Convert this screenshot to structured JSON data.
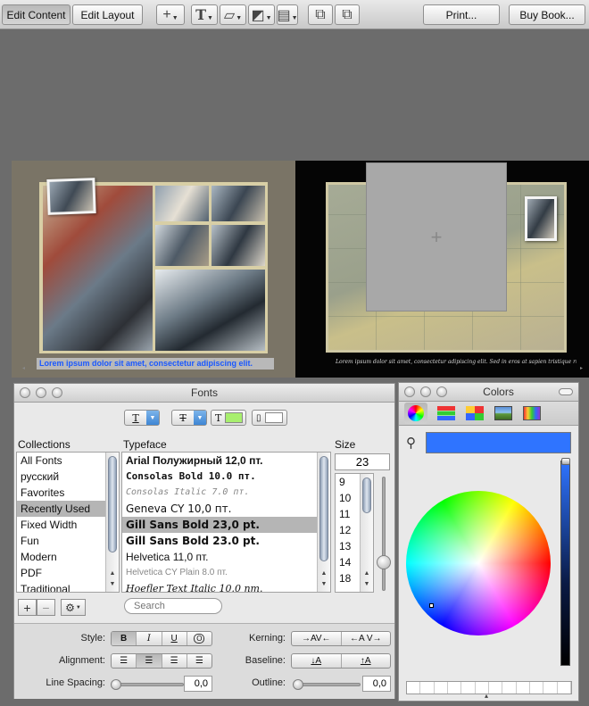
{
  "toolbar": {
    "edit_content": "Edit Content",
    "edit_layout": "Edit Layout",
    "print": "Print...",
    "buy_book": "Buy Book..."
  },
  "spread": {
    "caption_left": "Lorem ipsum dolor sit amet, consectetur adipiscing elit.",
    "caption_right": "Lorem ipsum dolor sit amet, consectetur adipiscing elit. Sed in eros at sapien tristique rutrum. Morbi in lacus non sapien."
  },
  "fonts_panel": {
    "title": "Fonts",
    "collections_header": "Collections",
    "typeface_header": "Typeface",
    "size_header": "Size",
    "collections": [
      "All Fonts",
      "русский",
      "Favorites",
      "Recently Used",
      "Fixed Width",
      "Fun",
      "Modern",
      "PDF",
      "Traditional"
    ],
    "selected_collection": "Recently Used",
    "typefaces": [
      "Arial Полужирный 12,0 пт.",
      "Consolas Bold 10.0 пт.",
      "Consolas Italic 7.0 пт.",
      "Geneva CY 10,0 пт.",
      "Gill Sans Bold 23,0 pt.",
      "Gill Sans Bold 23.0 pt.",
      "Helvetica 11,0 пт.",
      "Helvetica CY Plain 8.0 пт.",
      "Hoefler Text Italic 10.0 пт."
    ],
    "selected_typeface": "Gill Sans Bold 23,0 pt.",
    "size_value": "23",
    "sizes": [
      "9",
      "10",
      "11",
      "12",
      "13",
      "14",
      "18"
    ],
    "search_placeholder": "Search",
    "style_label": "Style:",
    "style_buttons": [
      "B",
      "I",
      "U",
      "O"
    ],
    "alignment_label": "Alignment:",
    "line_spacing_label": "Line Spacing:",
    "line_spacing_value": "0,0",
    "kerning_label": "Kerning:",
    "kerning_tighten": "→AV←",
    "kerning_loosen": "←A V→",
    "baseline_label": "Baseline:",
    "baseline_lower": "↓A",
    "baseline_raise": "↑A",
    "outline_label": "Outline:",
    "outline_value": "0,0"
  },
  "colors_panel": {
    "title": "Colors",
    "current_color": "#2f74ff"
  }
}
